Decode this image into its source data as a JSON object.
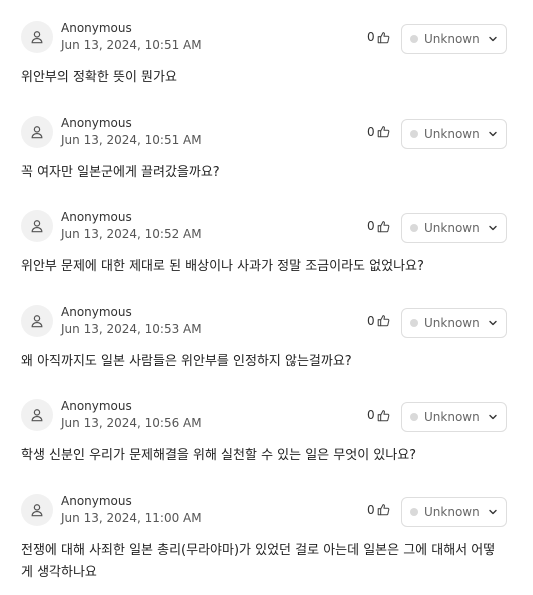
{
  "posts": [
    {
      "author": "Anonymous",
      "timestamp": "Jun 13, 2024, 10:51 AM",
      "likes": "0",
      "status": "Unknown",
      "body": "위안부의 정확한 뜻이 뭔가요"
    },
    {
      "author": "Anonymous",
      "timestamp": "Jun 13, 2024, 10:51 AM",
      "likes": "0",
      "status": "Unknown",
      "body": "꼭 여자만 일본군에게 끌려갔을까요?"
    },
    {
      "author": "Anonymous",
      "timestamp": "Jun 13, 2024, 10:52 AM",
      "likes": "0",
      "status": "Unknown",
      "body": "위안부 문제에 대한 제대로 된 배상이나 사과가 정말 조금이라도 없었나요?"
    },
    {
      "author": "Anonymous",
      "timestamp": "Jun 13, 2024, 10:53 AM",
      "likes": "0",
      "status": "Unknown",
      "body": "왜 아직까지도 일본 사람들은 위안부를 인정하지 않는걸까요?"
    },
    {
      "author": "Anonymous",
      "timestamp": "Jun 13, 2024, 10:56 AM",
      "likes": "0",
      "status": "Unknown",
      "body": "학생 신분인 우리가 문제해결을 위해 실천할 수 있는 일은 무엇이 있나요?"
    },
    {
      "author": "Anonymous",
      "timestamp": "Jun 13, 2024, 11:00 AM",
      "likes": "0",
      "status": "Unknown",
      "body": "전쟁에 대해 사죄한 일본 총리(무라야마)가 있었던 걸로 아는데 일본은 그에 대해서 어떻게 생각하나요"
    }
  ],
  "icons": {
    "avatar": "user-icon",
    "like": "thumbs-up-icon",
    "dropdown": "chevron-down-icon",
    "status_dot": "status-dot-icon"
  },
  "colors": {
    "status_dot": "#d9d9d9",
    "avatar_bg": "#f1f1f1",
    "border": "#dedede"
  }
}
